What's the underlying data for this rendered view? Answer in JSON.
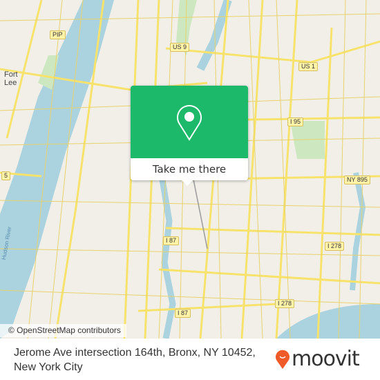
{
  "map": {
    "labels": {
      "fort_lee": "Fort\nLee",
      "hudson": "Hudson River"
    },
    "shields": [
      "PIP",
      "US 9",
      "US 1",
      "I 95",
      "NY 895",
      "I 87",
      "I 87",
      "I 278",
      "I 278",
      "5"
    ],
    "attribution": "© OpenStreetMap contributors",
    "colors": {
      "land": "#f2efe9",
      "water": "#aad3df",
      "road": "#f7e36b",
      "park": "#cde8c1",
      "accent": "#1db96a"
    }
  },
  "popup": {
    "icon": "map-pin-icon",
    "button_label": "Take me there"
  },
  "footer": {
    "address": "Jerome Ave intersection 164th, Bronx, NY 10452, New York City",
    "brand": "moovit",
    "brand_color": "#f05a28"
  }
}
